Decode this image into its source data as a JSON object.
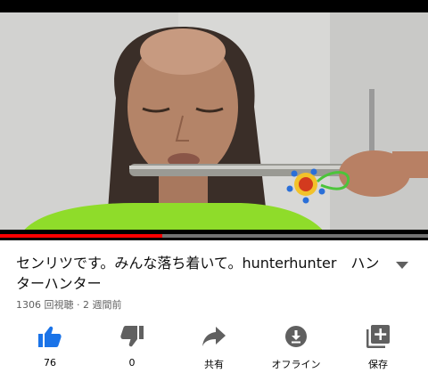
{
  "video": {
    "progress_fraction": 0.38
  },
  "title": "センリツです。みんな落ち着いて。hunterhunter　ハンターハンター",
  "meta": "1306 回視聴 · 2 週間前",
  "actions": [
    {
      "name": "like",
      "label": "76",
      "icon": "thumbs-up-icon"
    },
    {
      "name": "dislike",
      "label": "0",
      "icon": "thumbs-down-icon"
    },
    {
      "name": "share",
      "label": "共有",
      "icon": "share-icon"
    },
    {
      "name": "offline",
      "label": "オフライン",
      "icon": "download-icon"
    },
    {
      "name": "save",
      "label": "保存",
      "icon": "playlist-add-icon"
    }
  ],
  "colors": {
    "like_active": "#1a73e8",
    "icon_gray": "#606060",
    "progress": "#ff0000"
  }
}
